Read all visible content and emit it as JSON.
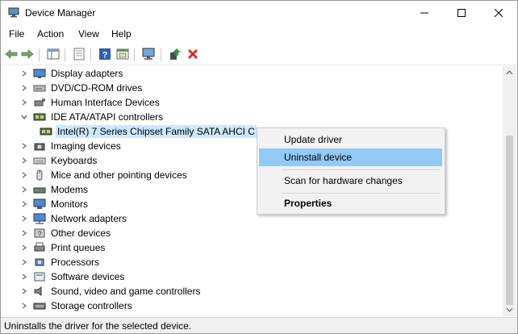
{
  "window": {
    "title": "Device Manager"
  },
  "menu": {
    "items": [
      "File",
      "Action",
      "View",
      "Help"
    ]
  },
  "toolbar": {
    "buttons": [
      "back-icon",
      "forward-icon",
      "show-hide-console-tree-icon",
      "properties-icon",
      "help-icon",
      "view-icon",
      "scan-hardware-icon",
      "update-driver-icon",
      "uninstall-icon"
    ]
  },
  "tree": {
    "rows": [
      {
        "label": "Display adapters",
        "icon": "display-adapter-icon",
        "expanded": false
      },
      {
        "label": "DVD/CD-ROM drives",
        "icon": "dvd-drive-icon",
        "expanded": false
      },
      {
        "label": "Human Interface Devices",
        "icon": "hid-icon",
        "expanded": false
      },
      {
        "label": "IDE ATA/ATAPI controllers",
        "icon": "ide-controller-icon",
        "expanded": true
      },
      {
        "label": "Intel(R) 7 Series Chipset Family SATA AHCI C",
        "icon": "ide-controller-icon",
        "child": true,
        "selected": true
      },
      {
        "label": "Imaging devices",
        "icon": "camera-icon",
        "expanded": false
      },
      {
        "label": "Keyboards",
        "icon": "keyboard-icon",
        "expanded": false
      },
      {
        "label": "Mice and other pointing devices",
        "icon": "mouse-icon",
        "expanded": false
      },
      {
        "label": "Modems",
        "icon": "modem-icon",
        "expanded": false
      },
      {
        "label": "Monitors",
        "icon": "monitor-icon",
        "expanded": false
      },
      {
        "label": "Network adapters",
        "icon": "network-adapter-icon",
        "expanded": false
      },
      {
        "label": "Other devices",
        "icon": "other-device-icon",
        "expanded": false
      },
      {
        "label": "Print queues",
        "icon": "printer-icon",
        "expanded": false
      },
      {
        "label": "Processors",
        "icon": "processor-icon",
        "expanded": false
      },
      {
        "label": "Software devices",
        "icon": "software-device-icon",
        "expanded": false
      },
      {
        "label": "Sound, video and game controllers",
        "icon": "speaker-icon",
        "expanded": false
      },
      {
        "label": "Storage controllers",
        "icon": "storage-controller-icon",
        "expanded": false
      }
    ]
  },
  "context_menu": {
    "update": "Update driver",
    "uninstall": "Uninstall device",
    "scan": "Scan for hardware changes",
    "properties": "Properties"
  },
  "status": {
    "text": "Uninstalls the driver for the selected device."
  },
  "colors": {
    "hover": "#91c9f7",
    "selected": "#cce8ff",
    "uninstall_red": "#d32f2f"
  }
}
